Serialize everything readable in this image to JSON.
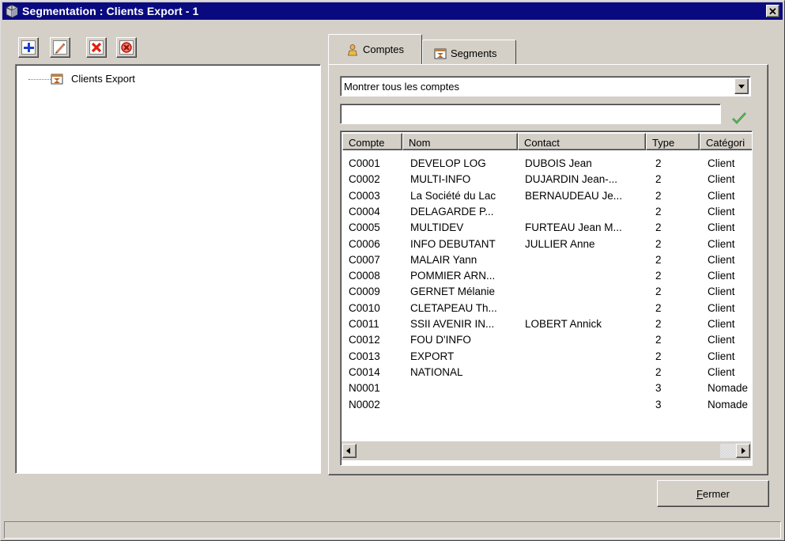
{
  "window": {
    "title": "Segmentation : Clients Export - 1",
    "close_glyph": "✕"
  },
  "toolbar": {
    "buttons": [
      {
        "name": "add-icon",
        "color": "#1a3fd0"
      },
      {
        "name": "edit-icon",
        "color": "#c06040"
      },
      {
        "name": "delete-icon",
        "color": "#e02010"
      },
      {
        "name": "cancel-icon",
        "color": "#e02010"
      }
    ]
  },
  "tree": {
    "root_label": "Clients Export"
  },
  "tabs": [
    {
      "label": "Comptes",
      "icon": "person-icon",
      "active": true
    },
    {
      "label": "Segments",
      "icon": "segment-icon",
      "active": false
    }
  ],
  "filter": {
    "combo_value": "Montrer tous les comptes",
    "text_value": ""
  },
  "grid": {
    "columns": [
      "Compte",
      "Nom",
      "Contact",
      "Type",
      "Catégori"
    ],
    "rows": [
      [
        "C0001",
        "DEVELOP LOG",
        "DUBOIS Jean",
        "2",
        "Client"
      ],
      [
        "C0002",
        "MULTI-INFO",
        "DUJARDIN Jean-...",
        "2",
        "Client"
      ],
      [
        "C0003",
        "La Société du Lac",
        "BERNAUDEAU Je...",
        "2",
        "Client"
      ],
      [
        "C0004",
        "DELAGARDE P...",
        "",
        "2",
        "Client"
      ],
      [
        "C0005",
        "MULTIDEV",
        "FURTEAU Jean M...",
        "2",
        "Client"
      ],
      [
        "C0006",
        "INFO DEBUTANT",
        "JULLIER Anne",
        "2",
        "Client"
      ],
      [
        "C0007",
        "MALAIR Yann",
        "",
        "2",
        "Client"
      ],
      [
        "C0008",
        "POMMIER ARN...",
        "",
        "2",
        "Client"
      ],
      [
        "C0009",
        "GERNET Mélanie",
        "",
        "2",
        "Client"
      ],
      [
        "C0010",
        "CLETAPEAU Th...",
        "",
        "2",
        "Client"
      ],
      [
        "C0011",
        "SSII AVENIR IN...",
        "LOBERT Annick",
        "2",
        "Client"
      ],
      [
        "C0012",
        "FOU D'INFO",
        "",
        "2",
        "Client"
      ],
      [
        "C0013",
        "EXPORT",
        "",
        "2",
        "Client"
      ],
      [
        "C0014",
        "NATIONAL",
        "",
        "2",
        "Client"
      ],
      [
        "N0001",
        "",
        "",
        "3",
        "Nomade"
      ],
      [
        "N0002",
        "",
        "",
        "3",
        "Nomade"
      ]
    ]
  },
  "buttons": {
    "close_label_mnemonic": "F",
    "close_label_rest": "ermer"
  }
}
